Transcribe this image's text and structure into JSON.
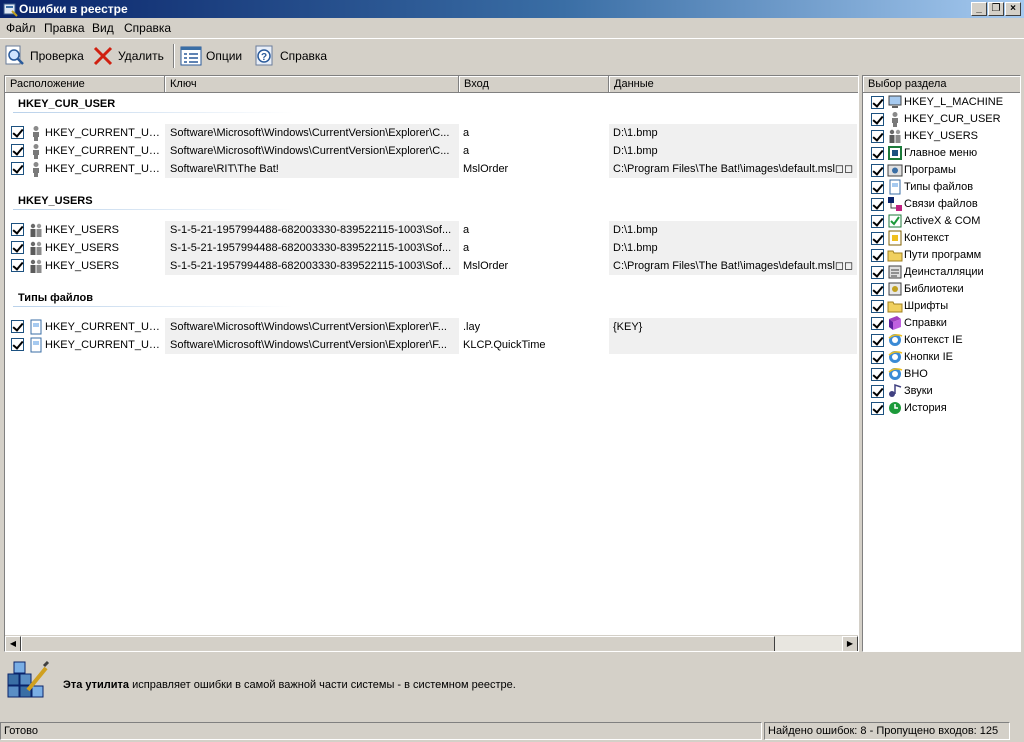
{
  "window": {
    "title": "Ошибки в реестре"
  },
  "menu": {
    "items": [
      "Файл",
      "Правка",
      "Вид",
      "Справка"
    ]
  },
  "toolbar": {
    "scan": "Проверка",
    "delete": "Удалить",
    "options": "Опции",
    "help": "Справка"
  },
  "columns": {
    "location": "Расположение",
    "key": "Ключ",
    "entry": "Вход",
    "data": "Данные"
  },
  "groups": [
    {
      "title": "HKEY_CUR_USER",
      "rows": [
        {
          "location": "HKEY_CURRENT_USER",
          "key": "Software\\Microsoft\\Windows\\CurrentVersion\\Explorer\\C...",
          "entry": "a",
          "data": "D:\\1.bmp"
        },
        {
          "location": "HKEY_CURRENT_USER",
          "key": "Software\\Microsoft\\Windows\\CurrentVersion\\Explorer\\C...",
          "entry": "a",
          "data": "D:\\1.bmp"
        },
        {
          "location": "HKEY_CURRENT_USER",
          "key": "Software\\RIT\\The Bat!",
          "entry": "MslOrder",
          "data": "C:\\Program Files\\The Bat!\\images\\default.msl◻◻"
        }
      ]
    },
    {
      "title": "HKEY_USERS",
      "rows": [
        {
          "location": "HKEY_USERS",
          "key": "S-1-5-21-1957994488-682003330-839522115-1003\\Sof...",
          "entry": "a",
          "data": "D:\\1.bmp"
        },
        {
          "location": "HKEY_USERS",
          "key": "S-1-5-21-1957994488-682003330-839522115-1003\\Sof...",
          "entry": "a",
          "data": "D:\\1.bmp"
        },
        {
          "location": "HKEY_USERS",
          "key": "S-1-5-21-1957994488-682003330-839522115-1003\\Sof...",
          "entry": "MslOrder",
          "data": "C:\\Program Files\\The Bat!\\images\\default.msl◻◻"
        }
      ]
    },
    {
      "title": "Типы файлов",
      "rows": [
        {
          "location": "HKEY_CURRENT_USER",
          "key": "Software\\Microsoft\\Windows\\CurrentVersion\\Explorer\\F...",
          "entry": ".lay",
          "data": "{KEY}"
        },
        {
          "location": "HKEY_CURRENT_USER",
          "key": "Software\\Microsoft\\Windows\\CurrentVersion\\Explorer\\F...",
          "entry": "KLCP.QuickTime",
          "data": ""
        }
      ]
    }
  ],
  "sections": {
    "header": "Выбор раздела",
    "items": [
      {
        "label": "HKEY_L_MACHINE",
        "icon": "computer-icon"
      },
      {
        "label": "HKEY_CUR_USER",
        "icon": "user-icon"
      },
      {
        "label": "HKEY_USERS",
        "icon": "users-icon"
      },
      {
        "label": "Главное меню",
        "icon": "start-menu-icon"
      },
      {
        "label": "Програмы",
        "icon": "programs-icon"
      },
      {
        "label": "Типы файлов",
        "icon": "file-types-icon"
      },
      {
        "label": "Связи файлов",
        "icon": "file-links-icon"
      },
      {
        "label": "ActiveX & COM",
        "icon": "activex-icon"
      },
      {
        "label": "Контекст",
        "icon": "context-icon"
      },
      {
        "label": "Пути программ",
        "icon": "program-paths-icon"
      },
      {
        "label": "Деинсталляции",
        "icon": "uninstall-icon"
      },
      {
        "label": "Библиотеки",
        "icon": "libraries-icon"
      },
      {
        "label": "Шрифты",
        "icon": "fonts-icon"
      },
      {
        "label": "Справки",
        "icon": "help-books-icon"
      },
      {
        "label": "Контекст IE",
        "icon": "ie-icon"
      },
      {
        "label": "Кнопки IE",
        "icon": "ie-icon"
      },
      {
        "label": "BHO",
        "icon": "ie-icon"
      },
      {
        "label": "Звуки",
        "icon": "sounds-icon"
      },
      {
        "label": "История",
        "icon": "history-icon"
      }
    ]
  },
  "info": {
    "bold": "Эта утилита",
    "text": " исправляет ошибки в самой важной части системы - в системном реестре."
  },
  "status": {
    "left": "Готово",
    "right": "Найдено ошибок: 8 - Пропущено входов: 125"
  }
}
